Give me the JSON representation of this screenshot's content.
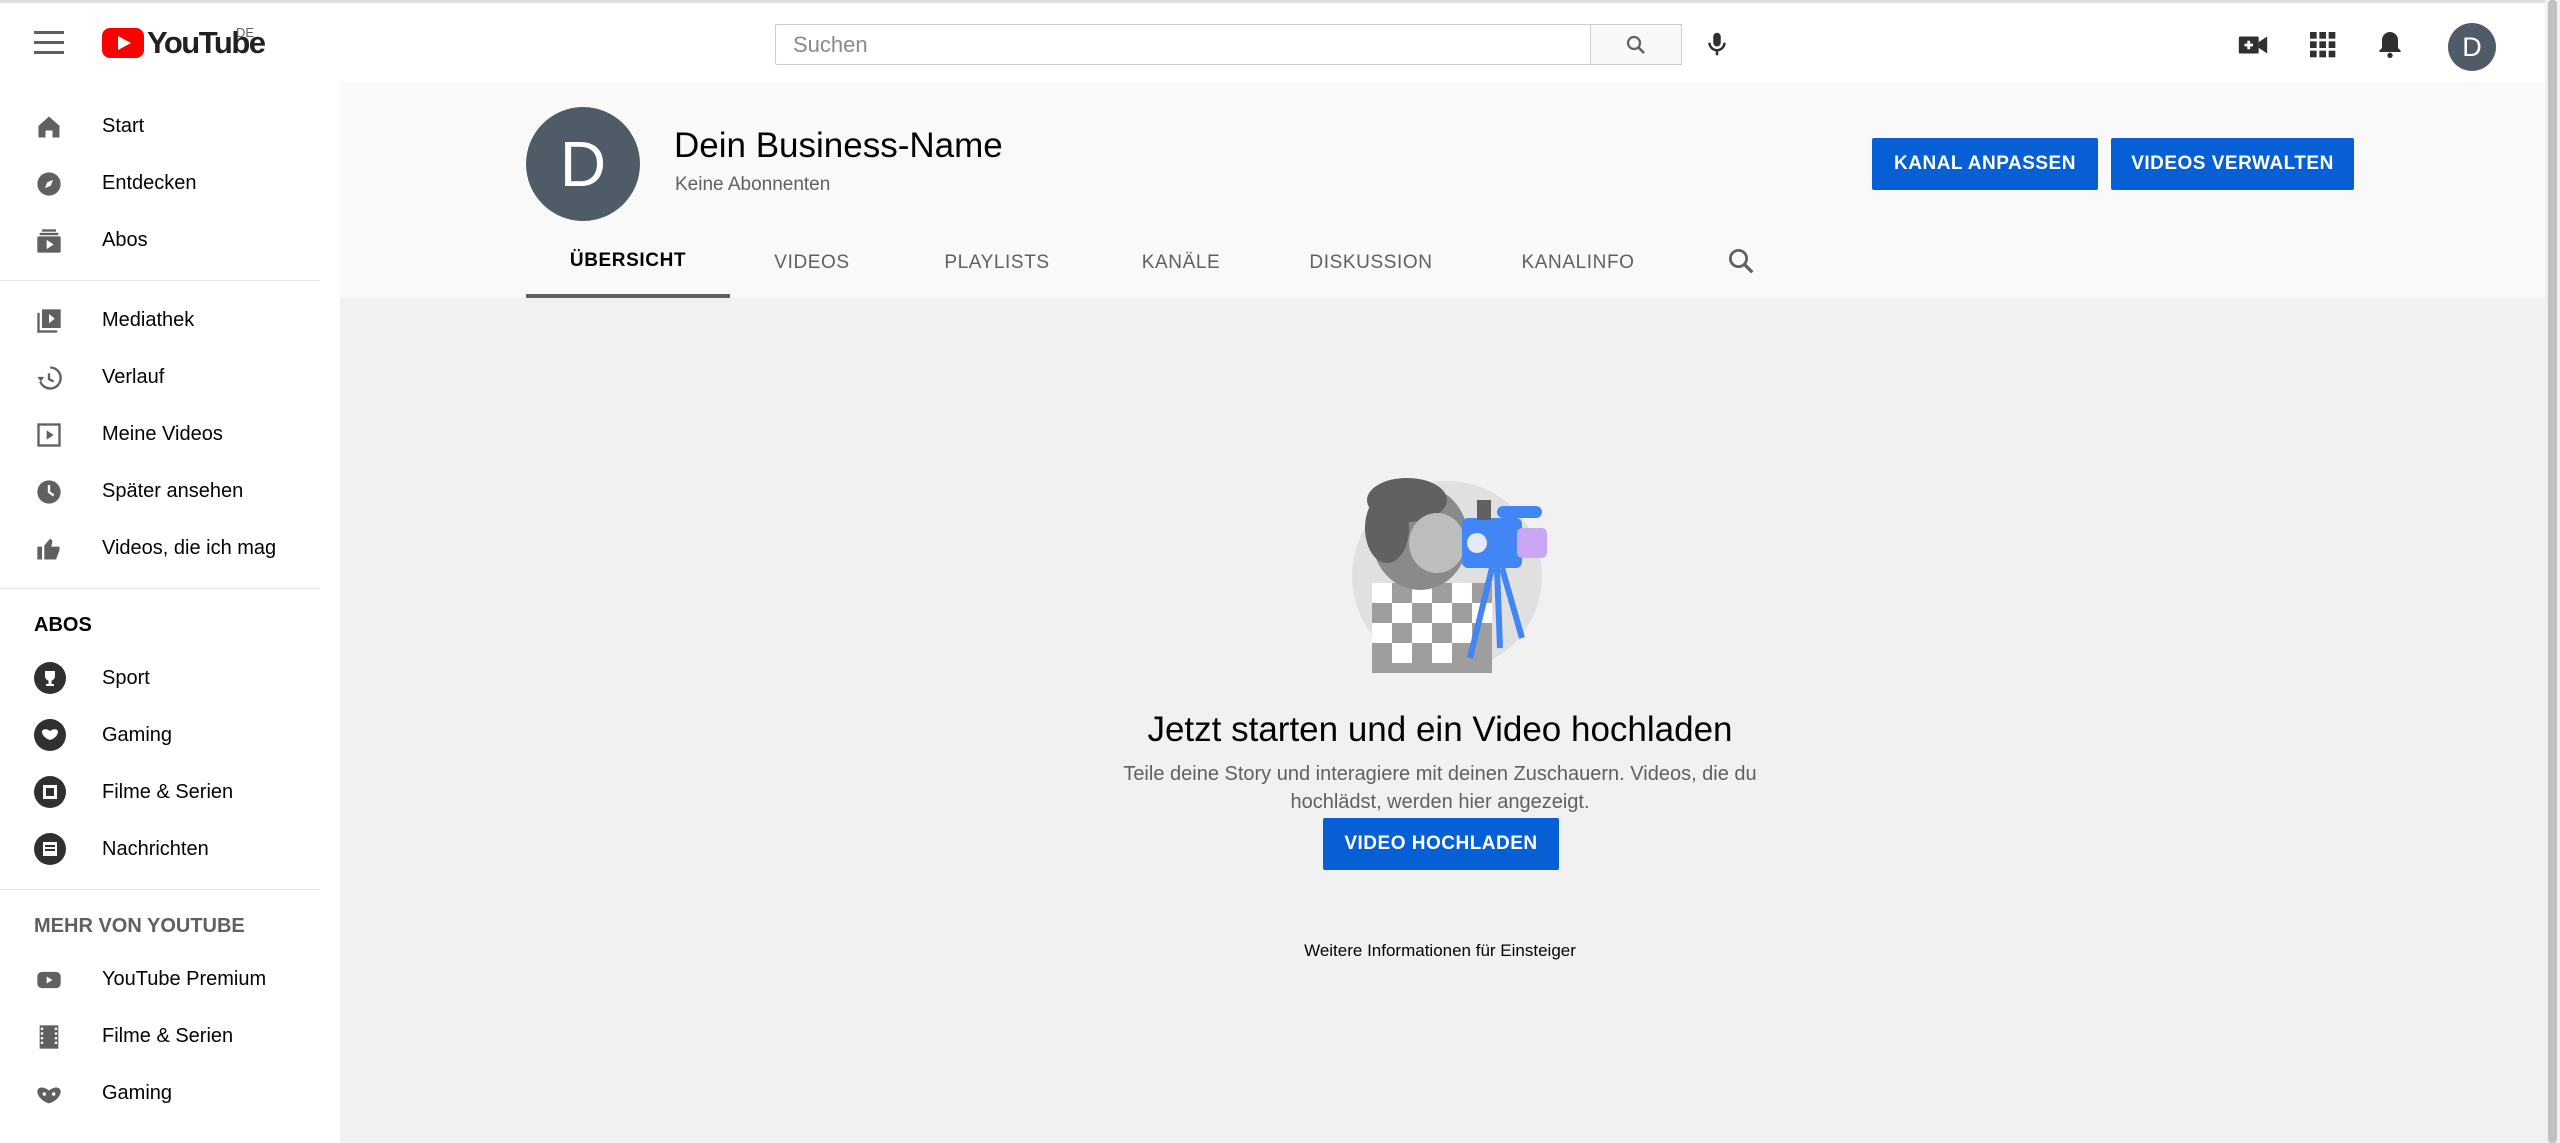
{
  "header": {
    "logo_text": "YouTube",
    "country_code": "DE",
    "search_placeholder": "Suchen",
    "avatar_letter": "D",
    "icons": [
      "menu-icon",
      "search-icon",
      "mic-icon",
      "create-video-icon",
      "apps-icon",
      "notifications-icon"
    ]
  },
  "sidebar": {
    "primary": [
      {
        "label": "Start",
        "icon": "home-icon"
      },
      {
        "label": "Entdecken",
        "icon": "explore-icon"
      },
      {
        "label": "Abos",
        "icon": "subscriptions-icon"
      }
    ],
    "library": [
      {
        "label": "Mediathek",
        "icon": "library-icon"
      },
      {
        "label": "Verlauf",
        "icon": "history-icon"
      },
      {
        "label": "Meine Videos",
        "icon": "your-videos-icon"
      },
      {
        "label": "Später ansehen",
        "icon": "watch-later-icon"
      },
      {
        "label": "Videos, die ich mag",
        "icon": "like-icon"
      }
    ],
    "abos_heading": "ABOS",
    "abos": [
      {
        "label": "Sport",
        "icon": "trophy-icon"
      },
      {
        "label": "Gaming",
        "icon": "gaming-icon"
      },
      {
        "label": "Filme & Serien",
        "icon": "film-icon"
      },
      {
        "label": "Nachrichten",
        "icon": "news-icon"
      }
    ],
    "more_heading": "MEHR VON YOUTUBE",
    "more": [
      {
        "label": "YouTube Premium",
        "icon": "youtube-premium-icon"
      },
      {
        "label": "Filme & Serien",
        "icon": "film-icon"
      },
      {
        "label": "Gaming",
        "icon": "gaming-icon"
      }
    ]
  },
  "channel": {
    "avatar_letter": "D",
    "name": "Dein Business-Name",
    "subscribers": "Keine Abonnenten",
    "customize_button": "KANAL ANPASSEN",
    "manage_button": "VIDEOS VERWALTEN",
    "tabs": [
      "ÜBERSICHT",
      "VIDEOS",
      "PLAYLISTS",
      "KANÄLE",
      "DISKUSSION",
      "KANALINFO"
    ],
    "active_tab": "ÜBERSICHT"
  },
  "empty_state": {
    "title": "Jetzt starten und ein Video hochladen",
    "description": "Teile deine Story und interagiere mit deinen Zuschauern. Videos, die du hochlädst, werden hier angezeigt.",
    "upload_button": "VIDEO HOCHLADEN",
    "learn_more": "Weitere Informationen für Einsteiger"
  },
  "colors": {
    "brand_red": "#ff0000",
    "accent_blue": "#065fd4",
    "avatar_bg": "#4f5b66"
  }
}
